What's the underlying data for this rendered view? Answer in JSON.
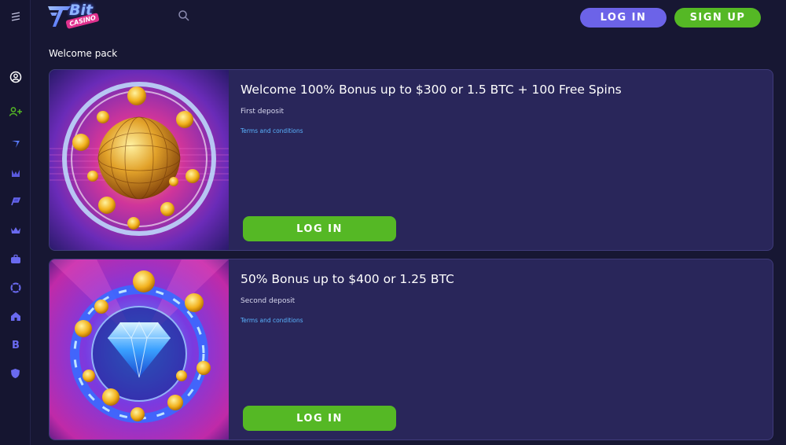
{
  "header": {
    "logo_bit": "Bit",
    "logo_casino": "CASINO",
    "login_label": "LOG IN",
    "signup_label": "SIGN UP"
  },
  "sidebar": {
    "items": [
      {
        "icon": "menu-icon"
      },
      {
        "icon": "user-circle-icon"
      },
      {
        "icon": "add-user-icon"
      },
      {
        "icon": "bitcasino-logo-icon"
      },
      {
        "icon": "cards-icon"
      },
      {
        "icon": "flags-icon"
      },
      {
        "icon": "crown-icon"
      },
      {
        "icon": "briefcase-icon"
      },
      {
        "icon": "lifebuoy-icon"
      },
      {
        "icon": "home-icon"
      },
      {
        "icon": "bitcoin-icon"
      },
      {
        "icon": "shield-icon"
      }
    ]
  },
  "main": {
    "section_title": "Welcome pack",
    "offers": [
      {
        "title": "Welcome 100% Bonus up to $300 or 1.5 BTC + 100 Free Spins",
        "subtitle": "First deposit",
        "terms_label": "Terms and conditions",
        "button_label": "LOG IN"
      },
      {
        "title": "50% Bonus up to $400 or 1.25 BTC",
        "subtitle": "Second deposit",
        "terms_label": "Terms and conditions",
        "button_label": "LOG IN"
      }
    ]
  },
  "colors": {
    "background": "#171733",
    "card": "#29265a",
    "accent_purple": "#6c63e8",
    "accent_green": "#55b825",
    "link_blue": "#5ab4ff"
  }
}
